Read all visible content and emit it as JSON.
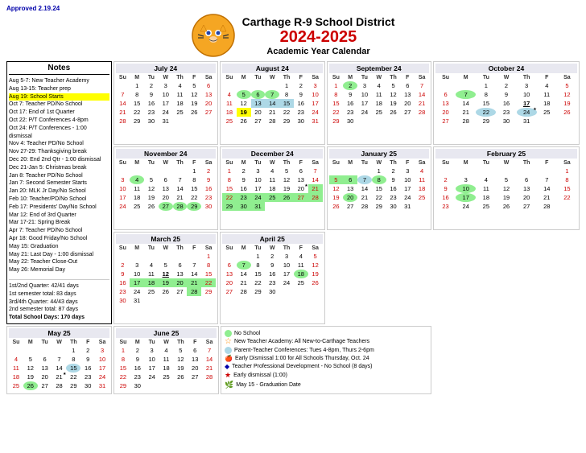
{
  "header": {
    "approved": "Approved 2.19.24",
    "school": "Carthage R-9 School District",
    "year": "2024-2025",
    "subtitle": "Academic Year Calendar"
  },
  "notes": {
    "title": "Notes",
    "items": [
      "Aug 5-7: New Teacher Academy",
      "Aug 13-15: Teacher prep",
      "Aug 19: School Starts",
      "Oct 7: Teacher PD/No School",
      "Oct 17: End of 1st Quarter",
      "Oct 22: P/T Conferences 4-8pm",
      "Oct 24: P/T Conferences - 1:00 dismissal",
      "Nov 4: Teacher PD/No School",
      "Nov 27-29: Thanksgiving break",
      "Dec 20: End 2nd Qtr - 1:00 dismissal",
      "Dec 21-Jan 5: Christmas break",
      "Jan 8: Teacher PD/No School",
      "Jan 7: Second Semester Starts",
      "Jan 20: MLK Jr Day/No School",
      "Feb 10: Teacher/PD/No School",
      "Feb 17: Presidents' Day/No School",
      "Mar 12: End of 3rd Quarter",
      "Mar 17-21: Spring Break",
      "Apr 7: Teacher PD/No School",
      "Apr 18: Good Friday/No School",
      "May 15: Graduation",
      "May 21: Last Day - 1:00 dismissal",
      "May 22: Teacher Close-Out",
      "May 26: Memorial Day"
    ],
    "stats": [
      "1st/2nd Quarter: 42/41 days",
      "1st semester total: 83 days",
      "3rd/4th Quarter: 44/43 days",
      "2nd semester total: 87 days",
      "Total School Days: 170 days"
    ]
  },
  "months": {
    "jul24": {
      "title": "July 24",
      "days": [
        [
          null,
          1,
          2,
          3,
          4,
          5,
          6
        ],
        [
          7,
          8,
          9,
          10,
          11,
          12,
          13
        ],
        [
          14,
          15,
          16,
          17,
          18,
          19,
          20
        ],
        [
          21,
          22,
          23,
          24,
          25,
          26,
          27
        ],
        [
          28,
          29,
          30,
          31,
          null,
          null,
          null
        ]
      ]
    },
    "aug24": {
      "title": "August 24",
      "days": [
        [
          null,
          null,
          null,
          null,
          1,
          2,
          3
        ],
        [
          4,
          5,
          6,
          7,
          8,
          9,
          10
        ],
        [
          11,
          12,
          13,
          14,
          15,
          16,
          17
        ],
        [
          18,
          19,
          20,
          21,
          22,
          23,
          24
        ],
        [
          25,
          26,
          27,
          28,
          29,
          30,
          31
        ]
      ]
    },
    "sep24": {
      "title": "September 24",
      "days": [
        [
          1,
          2,
          3,
          4,
          5,
          6,
          7
        ],
        [
          8,
          9,
          10,
          11,
          12,
          13,
          14
        ],
        [
          15,
          16,
          17,
          18,
          19,
          20,
          21
        ],
        [
          22,
          23,
          24,
          25,
          26,
          27,
          28
        ],
        [
          29,
          30,
          null,
          null,
          null,
          null,
          null
        ]
      ]
    },
    "oct24": {
      "title": "October 24",
      "days": [
        [
          null,
          null,
          1,
          2,
          3,
          4,
          5
        ],
        [
          6,
          7,
          8,
          9,
          10,
          11,
          12
        ],
        [
          13,
          14,
          15,
          16,
          17,
          18,
          19
        ],
        [
          20,
          21,
          22,
          23,
          24,
          25,
          26
        ],
        [
          27,
          28,
          29,
          30,
          31,
          null,
          null
        ]
      ]
    },
    "nov24": {
      "title": "November 24",
      "days": [
        [
          null,
          null,
          null,
          null,
          null,
          1,
          2
        ],
        [
          3,
          4,
          5,
          6,
          7,
          8,
          9
        ],
        [
          10,
          11,
          12,
          13,
          14,
          15,
          16
        ],
        [
          17,
          18,
          19,
          20,
          21,
          22,
          23
        ],
        [
          24,
          25,
          26,
          27,
          28,
          29,
          30
        ]
      ]
    },
    "dec24": {
      "title": "December 24",
      "days": [
        [
          1,
          2,
          3,
          4,
          5,
          6,
          7
        ],
        [
          8,
          9,
          10,
          11,
          12,
          13,
          14
        ],
        [
          15,
          16,
          17,
          18,
          19,
          20,
          21
        ],
        [
          22,
          23,
          24,
          25,
          26,
          27,
          28
        ],
        [
          29,
          30,
          31,
          null,
          null,
          null,
          null
        ]
      ]
    },
    "jan25": {
      "title": "January 25",
      "days": [
        [
          null,
          null,
          null,
          1,
          2,
          3,
          4
        ],
        [
          5,
          6,
          7,
          8,
          9,
          10,
          11
        ],
        [
          12,
          13,
          14,
          15,
          16,
          17,
          18
        ],
        [
          19,
          20,
          21,
          22,
          23,
          24,
          25
        ],
        [
          26,
          27,
          28,
          29,
          30,
          31,
          null
        ]
      ]
    },
    "feb25": {
      "title": "February 25",
      "days": [
        [
          null,
          null,
          null,
          null,
          null,
          null,
          1
        ],
        [
          2,
          3,
          4,
          5,
          6,
          7,
          8
        ],
        [
          9,
          10,
          11,
          12,
          13,
          14,
          15
        ],
        [
          16,
          17,
          18,
          19,
          20,
          21,
          22
        ],
        [
          23,
          24,
          25,
          26,
          27,
          28,
          null
        ]
      ]
    },
    "mar25": {
      "title": "March 25",
      "days": [
        [
          null,
          null,
          null,
          null,
          null,
          null,
          1
        ],
        [
          2,
          3,
          4,
          5,
          6,
          7,
          8
        ],
        [
          9,
          10,
          11,
          12,
          13,
          14,
          15
        ],
        [
          16,
          17,
          18,
          19,
          20,
          21,
          22
        ],
        [
          23,
          24,
          25,
          26,
          27,
          28,
          29
        ],
        [
          30,
          31,
          null,
          null,
          null,
          null,
          null
        ]
      ]
    },
    "apr25": {
      "title": "April 25",
      "days": [
        [
          null,
          null,
          1,
          2,
          3,
          4,
          5
        ],
        [
          6,
          7,
          8,
          9,
          10,
          11,
          12
        ],
        [
          13,
          14,
          15,
          16,
          17,
          18,
          19
        ],
        [
          20,
          21,
          22,
          23,
          24,
          25,
          26
        ],
        [
          27,
          28,
          29,
          30,
          null,
          null,
          null
        ]
      ]
    },
    "may25": {
      "title": "May 25",
      "days": [
        [
          null,
          null,
          null,
          null,
          1,
          2,
          3
        ],
        [
          4,
          5,
          6,
          7,
          8,
          9,
          10
        ],
        [
          11,
          12,
          13,
          14,
          15,
          16,
          17
        ],
        [
          18,
          19,
          20,
          21,
          22,
          23,
          24
        ],
        [
          25,
          26,
          27,
          28,
          29,
          30,
          31
        ]
      ]
    },
    "jun25": {
      "title": "June 25",
      "days": [
        [
          1,
          2,
          3,
          4,
          5,
          6,
          7
        ],
        [
          8,
          9,
          10,
          11,
          12,
          13,
          14
        ],
        [
          15,
          16,
          17,
          18,
          19,
          20,
          21
        ],
        [
          22,
          23,
          24,
          25,
          26,
          27,
          28
        ],
        [
          29,
          30,
          null,
          null,
          null,
          null,
          null
        ]
      ]
    }
  },
  "legend": {
    "no_school": "No School",
    "new_teacher": "New Teacher Academy: All New-to-Carthage Teachers",
    "conferences": "Parent-Teacher Conferences: Tues 4-8pm, Thurs 2-6pm",
    "early_dismissal_oct": "Early Dismissal 1:00 for All Schools Thursday, Oct. 24",
    "teacher_pd": "Teacher Professional Development - No School (8 days)",
    "early_dismissal": "Early dismissal (1:00)",
    "graduation": "May 15 - Graduation Date"
  },
  "days_header": [
    "Su",
    "M",
    "Tu",
    "W",
    "Th",
    "F",
    "Sa"
  ]
}
